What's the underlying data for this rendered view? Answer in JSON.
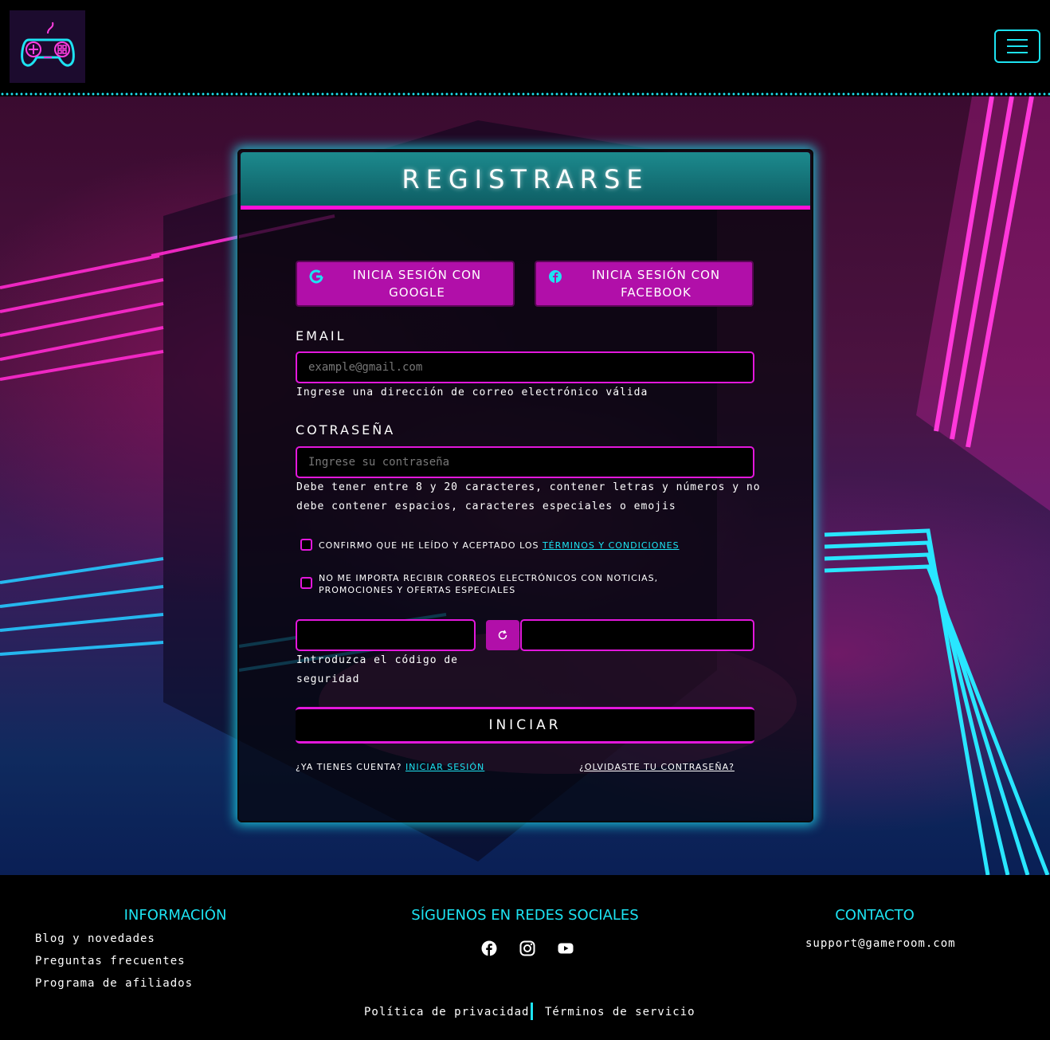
{
  "header": {
    "logo_alt": "gamepad",
    "menu": "menu"
  },
  "card": {
    "title": "REGISTRARSE",
    "google_btn": "INICIA SESIÓN CON GOOGLE",
    "facebook_btn": "INICIA SESIÓN CON FACEBOOK",
    "email_label": "EMAIL",
    "email_placeholder": "example@gmail.com",
    "email_hint": "Ingrese una dirección de correo electrónico válida",
    "password_label": "COTRASEÑA",
    "password_placeholder": "Ingrese su contraseña",
    "password_hint": "Debe tener entre 8 y 20 caracteres, contener letras y números y no debe contener espacios, caracteres especiales o emojis",
    "terms_text": "CONFIRMO QUE HE LEÍDO Y ACEPTADO LOS ",
    "terms_link": "TÉRMINOS Y CONDICIONES",
    "newsletter_text": "NO ME IMPORTA RECIBIR CORREOS ELECTRÓNICOS CON NOTICIAS, PROMOCIONES Y OFERTAS ESPECIALES",
    "captcha_hint": "Introduzca el código de seguridad",
    "submit": "INICIAR",
    "have_account": "¿YA TIENES CUENTA? ",
    "login_link": "INICIAR SESIÓN",
    "forgot_link": "¿OLVIDASTE TU CONTRASEÑA?"
  },
  "footer": {
    "info_title": "INFORMACIÓN",
    "info_links": [
      "Blog y novedades",
      "Preguntas frecuentes",
      "Programa de afiliados"
    ],
    "social_title": "SÍGUENOS EN REDES SOCIALES",
    "social_icons": [
      "facebook-icon",
      "instagram-icon",
      "youtube-icon"
    ],
    "contact_title": "CONTACTO",
    "email": "support@gameroom.com",
    "privacy": "Política de privacidad",
    "terms": "Términos de servicio"
  },
  "colors": {
    "accent_cyan": "#1de3f2",
    "accent_magenta": "#e317dc",
    "button_magenta": "#b10fa9"
  }
}
